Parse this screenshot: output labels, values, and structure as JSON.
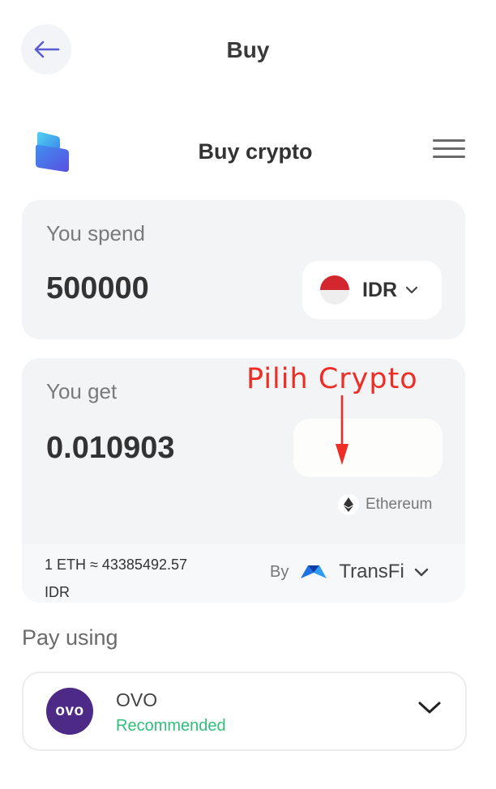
{
  "header": {
    "title": "Buy"
  },
  "widget": {
    "title": "Buy crypto"
  },
  "spend": {
    "label": "You spend",
    "amount": "500000",
    "currency": "IDR"
  },
  "get": {
    "label": "You get",
    "amount": "0.010903",
    "network": "Ethereum",
    "annotation": "Pilih Crypto",
    "rate_line1": "1 ETH ≈ 43385492.57",
    "rate_line2": "IDR",
    "by_label": "By",
    "provider": "TransFi"
  },
  "pay": {
    "label": "Pay using",
    "method_logo": "ovo",
    "method_name": "OVO",
    "method_badge": "Recommended"
  },
  "colors": {
    "accent": "#5b5bd6",
    "annotation": "#ee2e24",
    "recommended": "#2fbf7a",
    "ovo": "#4c2a86"
  },
  "icons": [
    "arrow-left-icon",
    "app-logo-icon",
    "menu-icon",
    "flag-id-icon",
    "chevron-down-icon",
    "ethereum-icon",
    "transfi-icon",
    "ovo-logo"
  ]
}
